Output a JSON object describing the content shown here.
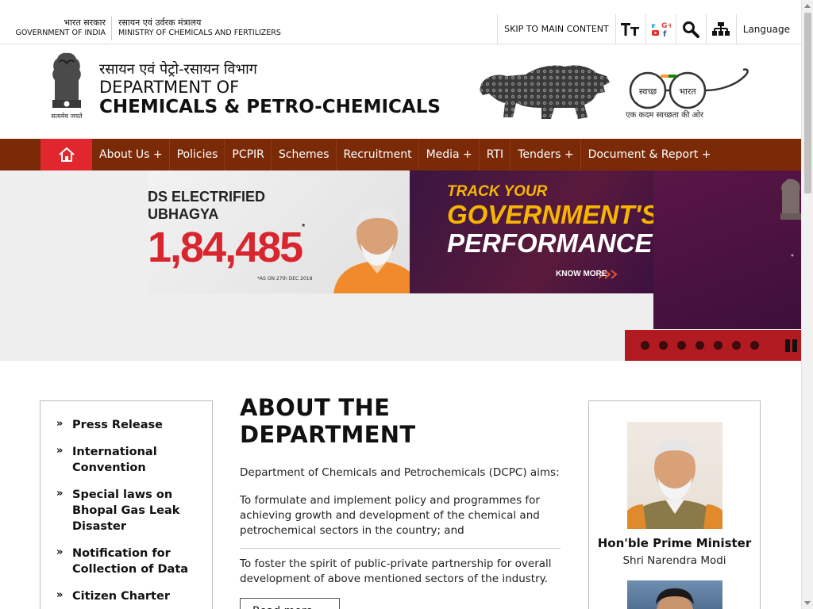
{
  "top_bar": {
    "gov_hindi": "भारत सरकार",
    "gov_english": "GOVERNMENT OF INDIA",
    "ministry_hindi": "रसायन एवं उर्वरक मंत्रालय",
    "ministry_english": "MINISTRY OF CHEMICALS AND FERTILIZERS",
    "skip_link": "SKIP TO MAIN CONTENT",
    "text_size_icon": "text-size-icon",
    "social_icon": "social-media-icon",
    "search_icon": "search-icon",
    "sitemap_icon": "sitemap-icon",
    "language": "Language"
  },
  "header": {
    "emblem_caption": "सत्यमेव जयते",
    "title_hindi": "रसायन एवं पेट्रो-रसायन विभाग",
    "title_line1": "DEPARTMENT OF",
    "title_line2": "CHEMICALS & PETRO-CHEMICALS",
    "swachh_word1": "स्वच्छ",
    "swachh_word2": "भारत",
    "swachh_caption": "एक कदम स्वच्छता की ओर"
  },
  "nav": {
    "home_icon": "home-icon",
    "items": [
      {
        "label": "About Us +"
      },
      {
        "label": "Policies"
      },
      {
        "label": "PCPIR"
      },
      {
        "label": "Schemes"
      },
      {
        "label": "Recruitment"
      },
      {
        "label": "Media +"
      },
      {
        "label": "RTI"
      },
      {
        "label": "Tenders +"
      },
      {
        "label": "Document & Report +"
      }
    ]
  },
  "banner": {
    "line1": "DS ELECTRIFIED",
    "line2": "UBHAGYA",
    "count": "1,84,485",
    "count_mark": "*",
    "as_of": "*AS ON 27th DEC 2018",
    "track_line1": "TRACK YOUR",
    "track_line2": "GOVERNMENT'S",
    "track_line3": "PERFORMANCE",
    "know_more": "KNOW MORE",
    "slide_count": 7,
    "active_slide": 1
  },
  "side_menu": {
    "items": [
      {
        "label": "Press Release"
      },
      {
        "label": "International Convention"
      },
      {
        "label": "Special laws on Bhopal Gas Leak Disaster"
      },
      {
        "label": "Notification for Collection of Data"
      },
      {
        "label": "Citizen Charter"
      }
    ]
  },
  "about": {
    "heading": "ABOUT THE DEPARTMENT",
    "intro": "Department of Chemicals and Petrochemicals (DCPC) aims:",
    "point1": "To formulate and implement policy and programmes for achieving growth and development of the chemical and petrochemical sectors in the country; and",
    "point2": "To foster the spirit of public-private partnership for overall development of above mentioned sectors of the industry.",
    "read_more": "Read more ..."
  },
  "leaders": {
    "pm_title": "Hon'ble Prime Minister",
    "pm_name": "Shri Narendra Modi"
  }
}
